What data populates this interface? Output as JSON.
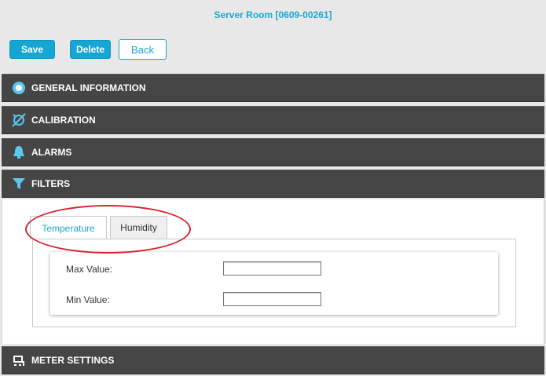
{
  "header": {
    "title": "Server Room [0609-00261]"
  },
  "toolbar": {
    "save_label": "Save",
    "delete_label": "Delete",
    "back_label": "Back"
  },
  "sections": {
    "general": "GENERAL INFORMATION",
    "calibration": "CALIBRATION",
    "alarms": "ALARMS",
    "filters": "FILTERS",
    "meter": "METER SETTINGS"
  },
  "filters": {
    "tabs": [
      "Temperature",
      "Humidity"
    ],
    "active_tab": "Temperature",
    "max_label": "Max Value:",
    "min_label": "Min Value:",
    "max_value": "",
    "min_value": ""
  },
  "colors": {
    "accent": "#17a6d3",
    "section_bg": "#454545",
    "annotation": "#d4232b"
  }
}
